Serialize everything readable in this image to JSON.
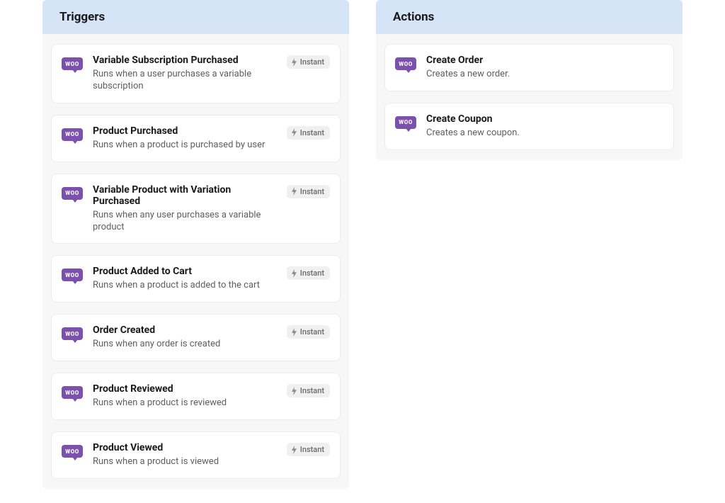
{
  "sections": {
    "triggers": {
      "header": "Triggers",
      "badgeLabel": "Instant",
      "items": [
        {
          "title": "Variable Subscription Purchased",
          "desc": "Runs when a user purchases a variable subscription"
        },
        {
          "title": "Product Purchased",
          "desc": "Runs when a product is purchased by user"
        },
        {
          "title": "Variable Product with Variation Purchased",
          "desc": "Runs when any user purchases a variable product"
        },
        {
          "title": "Product Added to Cart",
          "desc": "Runs when a product is added to the cart"
        },
        {
          "title": "Order Created",
          "desc": "Runs when any order is created"
        },
        {
          "title": "Product Reviewed",
          "desc": "Runs when a product is reviewed"
        },
        {
          "title": "Product Viewed",
          "desc": "Runs when a product is viewed"
        }
      ]
    },
    "actions": {
      "header": "Actions",
      "items": [
        {
          "title": "Create Order",
          "desc": "Creates a new order."
        },
        {
          "title": "Create Coupon",
          "desc": "Creates a new coupon."
        }
      ]
    }
  },
  "iconText": "WOO"
}
